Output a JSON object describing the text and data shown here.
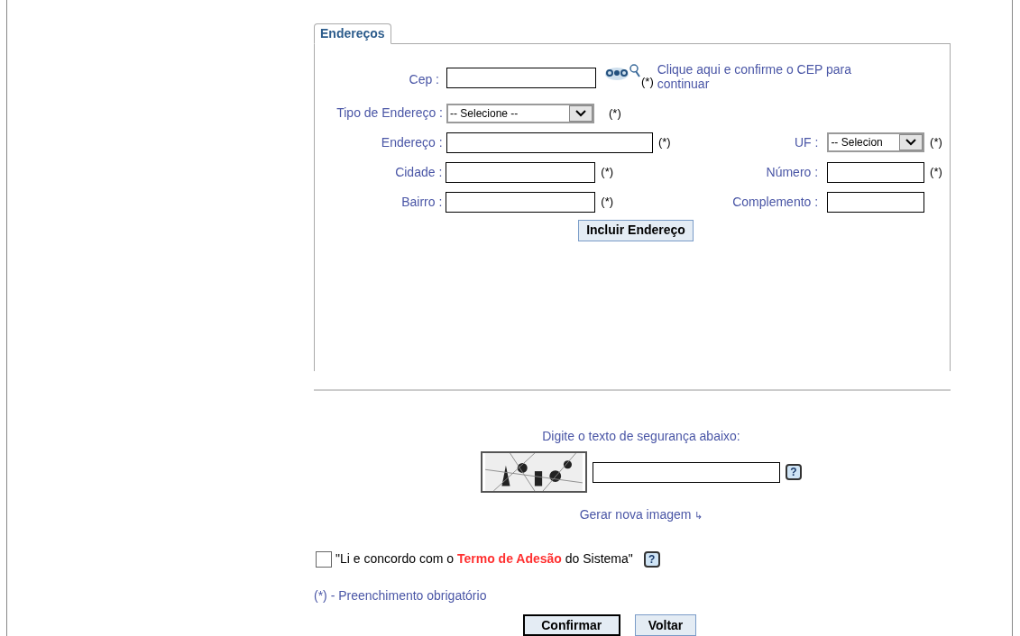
{
  "tab": {
    "label": "Endereços",
    "selected": true
  },
  "cep": {
    "label": "Cep :",
    "required": "(*)",
    "link": "Clique aqui e confirme o CEP para continuar"
  },
  "address_type": {
    "label": "Tipo de Endereço :",
    "value": "-- Selecione --",
    "required": "(*)"
  },
  "rows": [
    {
      "left": {
        "label": "Endereço :",
        "kind": "input",
        "wide": true,
        "required": "(*)"
      },
      "right": {
        "label": "UF :",
        "kind": "select",
        "value": "-- Selecion",
        "required": "(*)"
      }
    },
    {
      "left": {
        "label": "Cidade :",
        "kind": "input",
        "wide": false,
        "required": "(*)"
      },
      "right": {
        "label": "Número :",
        "kind": "input",
        "required": "(*)"
      }
    },
    {
      "left": {
        "label": "Bairro :",
        "kind": "input",
        "wide": false,
        "required": "(*)"
      },
      "right": {
        "label": "Complemento :",
        "kind": "input"
      }
    }
  ],
  "add_button": "Incluir Endereço",
  "captcha": {
    "prompt": "Digite o texto de segurança abaixo:",
    "help": "?",
    "regenerate": "Gerar nova imagem",
    "regenerate_arrow": "↳"
  },
  "agreement": {
    "checked": false,
    "text": "\"Li e concordo com o ",
    "link": "Termo de Adesão",
    "text_end": " do Sistema\"",
    "help": "?"
  },
  "required_note": "(*) - Preenchimento obrigatório",
  "buttons": [
    {
      "label": "Confirmar",
      "default": true
    },
    {
      "label": "Voltar",
      "default": false
    }
  ]
}
